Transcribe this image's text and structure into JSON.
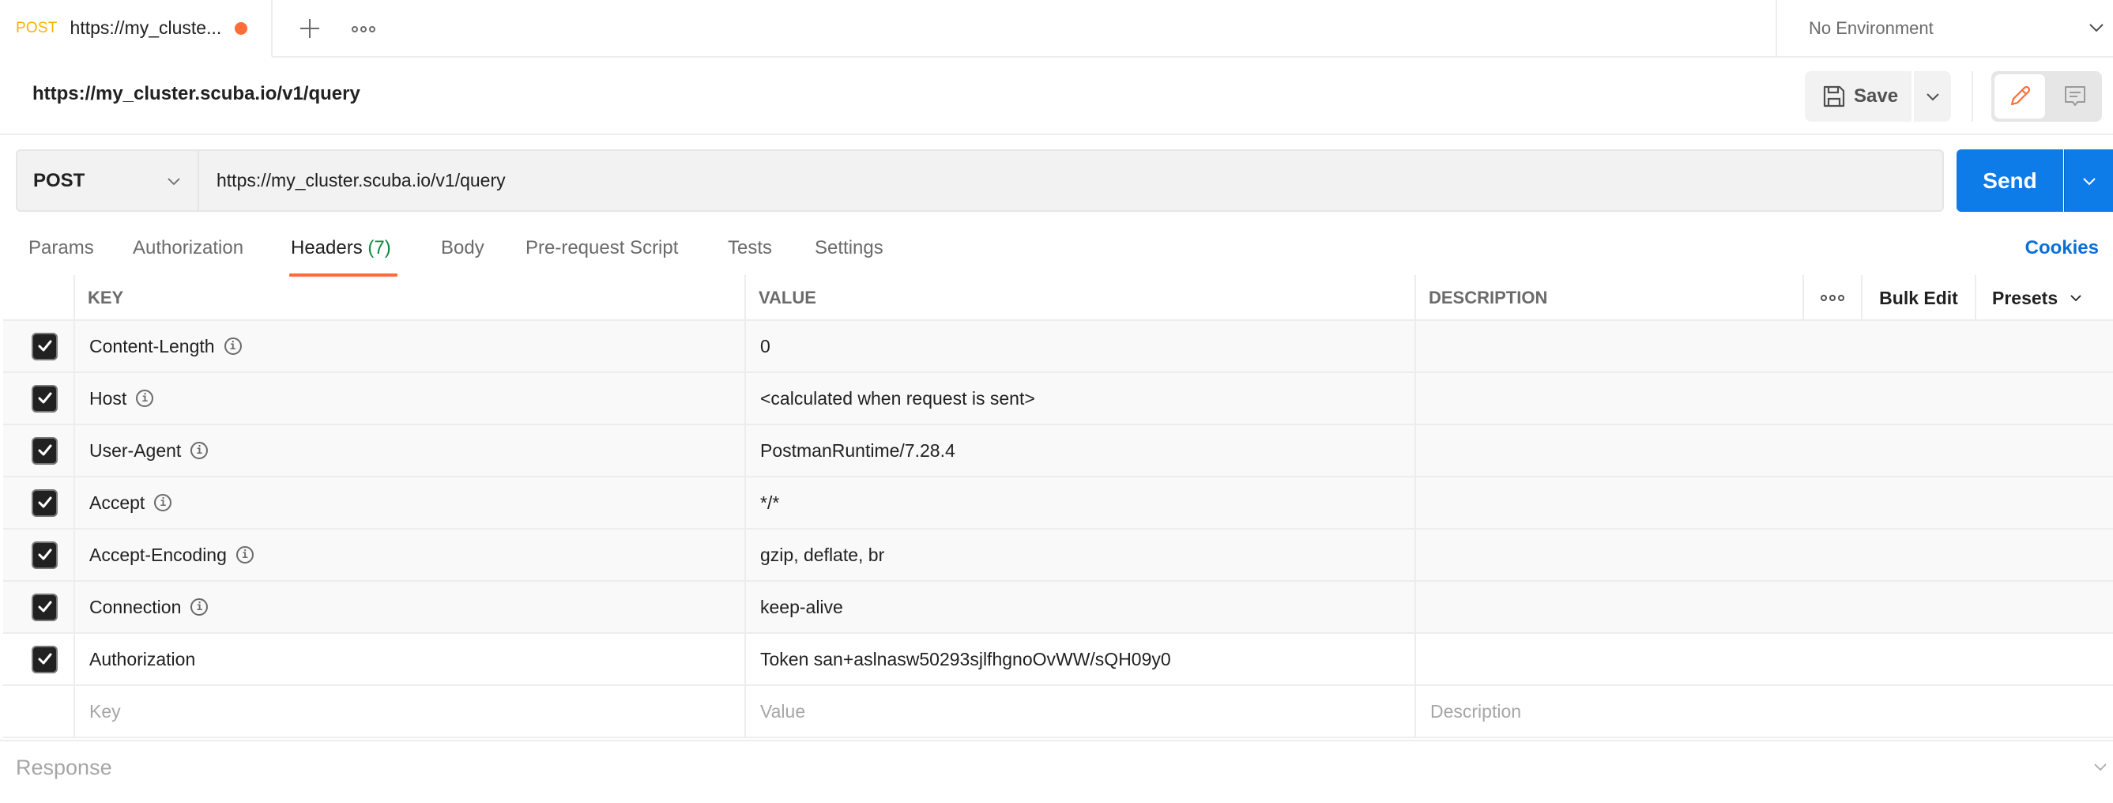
{
  "tabbar": {
    "active_tab": {
      "method": "POST",
      "name": "https://my_cluste...",
      "unsaved_indicator": true
    },
    "new_tab_icon": "plus-icon",
    "more_icon": "ellipsis-icon",
    "environment": {
      "selected": "No Environment"
    }
  },
  "request": {
    "title": "https://my_cluster.scuba.io/v1/query",
    "save_label": "Save",
    "method": "POST",
    "url": "https://my_cluster.scuba.io/v1/query",
    "send_label": "Send"
  },
  "subtabs": {
    "items": [
      {
        "label": "Params"
      },
      {
        "label": "Authorization"
      },
      {
        "label": "Headers",
        "count": "(7)",
        "active": true
      },
      {
        "label": "Body"
      },
      {
        "label": "Pre-request Script"
      },
      {
        "label": "Tests"
      },
      {
        "label": "Settings"
      }
    ],
    "cookies_label": "Cookies"
  },
  "headers_table": {
    "columns": {
      "key": "KEY",
      "value": "VALUE",
      "description": "DESCRIPTION",
      "bulk_edit": "Bulk Edit",
      "presets": "Presets"
    },
    "rows": [
      {
        "checked": true,
        "key": "Content-Length",
        "value": "0",
        "description": "",
        "info": true
      },
      {
        "checked": true,
        "key": "Host",
        "value": "<calculated when request is sent>",
        "description": "",
        "info": true
      },
      {
        "checked": true,
        "key": "User-Agent",
        "value": "PostmanRuntime/7.28.4",
        "description": "",
        "info": true
      },
      {
        "checked": true,
        "key": "Accept",
        "value": "*/*",
        "description": "",
        "info": true
      },
      {
        "checked": true,
        "key": "Accept-Encoding",
        "value": "gzip, deflate, br",
        "description": "",
        "info": true
      },
      {
        "checked": true,
        "key": "Connection",
        "value": "keep-alive",
        "description": "",
        "info": true
      },
      {
        "checked": true,
        "key": "Authorization",
        "value": "Token san+aslnasw50293sjlfhgnoOvWW/sQH09y0",
        "description": "",
        "info": false
      }
    ],
    "new_row": {
      "key_placeholder": "Key",
      "value_placeholder": "Value",
      "description_placeholder": "Description"
    }
  },
  "response": {
    "label": "Response"
  },
  "colors": {
    "accent_orange": "#ff6c37",
    "method_post": "#f4b400",
    "send_blue": "#0d7ce9",
    "cookies_blue": "#0b6fd6",
    "count_green": "#0b8a3e"
  }
}
